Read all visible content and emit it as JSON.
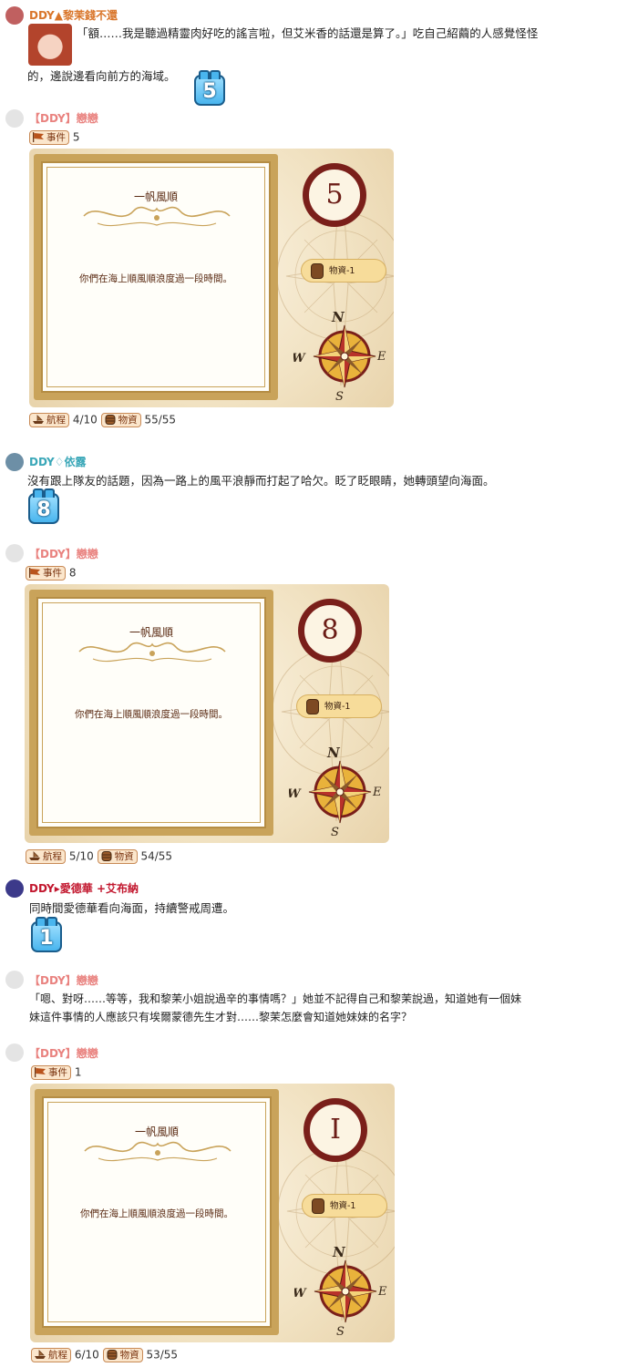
{
  "messages": [
    {
      "user": "DDY▲黎茉錢不還",
      "text_line1": "「額……我是聽過精靈肉好吃的謠言啦，但艾米香的話還是算了。」吃自己紹繭的人感覺怪怪",
      "text_line2": "的，邊說邊看向前方的海域。",
      "dice": "5"
    },
    {
      "user": "【DDY】戀戀",
      "event_label": "事件",
      "event_value": "5",
      "card": {
        "title": "一帆風順",
        "desc": "你們在海上順風順浪度過一段時間。",
        "number": "5",
        "supply": "物資-1"
      },
      "voyage_label": "航程",
      "voyage": "4/10",
      "supplies_label": "物資",
      "supplies": "55/55"
    },
    {
      "user": "DDY♢依露",
      "text_line1": "沒有跟上隊友的話題，因為一路上的風平浪靜而打起了哈欠。眨了眨眼睛，她轉頭望向海面。",
      "dice": "8"
    },
    {
      "user": "【DDY】戀戀",
      "event_label": "事件",
      "event_value": "8",
      "card": {
        "title": "一帆風順",
        "desc": "你們在海上順風順浪度過一段時間。",
        "number": "8",
        "supply": "物資-1"
      },
      "voyage_label": "航程",
      "voyage": "5/10",
      "supplies_label": "物資",
      "supplies": "54/55"
    },
    {
      "user": "DDY▸愛德華 +艾布納",
      "text_line1": "同時間愛德華看向海面，持續警戒周遭。",
      "dice": "1"
    },
    {
      "user": "【DDY】戀戀",
      "text_line1": "「嗯、對呀……等等，我和黎茉小姐說過辛的事情嗎？」她並不記得自己和黎茉說過，知道她有一個妹",
      "text_line2": "妹這件事情的人應該只有埃爾蒙德先生才對……黎茉怎麼會知道她妹妹的名字？"
    },
    {
      "user": "【DDY】戀戀",
      "event_label": "事件",
      "event_value": "1",
      "card": {
        "title": "一帆風順",
        "desc": "你們在海上順風順浪度過一段時間。",
        "number": "I",
        "supply": "物資-1"
      },
      "voyage_label": "航程",
      "voyage": "6/10",
      "supplies_label": "物資",
      "supplies": "53/55"
    }
  ],
  "compass_letters": {
    "n": "N",
    "s": "S",
    "e": "E",
    "w": "W"
  },
  "colors": {
    "user_orange": "#d9762b",
    "user_pink": "#e9827f",
    "user_teal": "#3aa7b8",
    "user_red": "#c2172e",
    "dice_blue": "#49b5ee",
    "card_brown": "#7a1f1a"
  },
  "icons": [
    "avatar",
    "dice-icon",
    "flag-icon",
    "ship-icon",
    "barrel-icon",
    "compass-icon"
  ]
}
